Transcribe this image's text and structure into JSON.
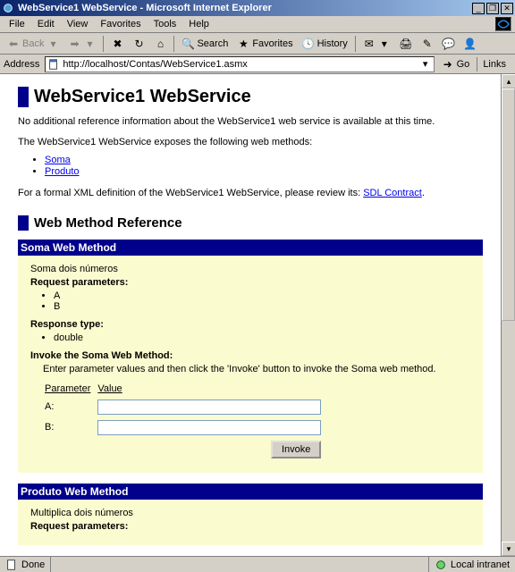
{
  "window": {
    "title": "WebService1 WebService - Microsoft Internet Explorer"
  },
  "menu": {
    "file": "File",
    "edit": "Edit",
    "view": "View",
    "favorites": "Favorites",
    "tools": "Tools",
    "help": "Help"
  },
  "toolbar": {
    "back": "Back",
    "search": "Search",
    "favorites": "Favorites",
    "history": "History"
  },
  "address": {
    "label": "Address",
    "url": "http://localhost/Contas/WebService1.asmx",
    "go": "Go",
    "links": "Links"
  },
  "page": {
    "h1": "WebService1 WebService",
    "intro": "No additional reference information about the WebService1 web service is available at this time.",
    "exposes": "The WebService1 WebService exposes the following web methods:",
    "links": {
      "soma": "Soma",
      "produto": "Produto"
    },
    "formal_pre": "For a formal XML definition of the WebService1 WebService, please review its: ",
    "sdl": "SDL Contract",
    "h2": "Web Method Reference",
    "soma": {
      "bar": "Soma Web Method",
      "desc": "Soma dois números",
      "req_label": "Request parameters:",
      "params": {
        "p1": "A",
        "p2": "B"
      },
      "resp_label": "Response type:",
      "resp": "double",
      "invoke_label": "Invoke the Soma Web Method:",
      "invoke_text": "Enter parameter values and then click the 'Invoke' button to invoke the Soma web method.",
      "table": {
        "hdr_param": "Parameter",
        "hdr_value": "Value",
        "p1": "A:",
        "p2": "B:"
      },
      "invoke_btn": "Invoke"
    },
    "produto": {
      "bar": "Produto Web Method",
      "desc": "Multiplica dois números",
      "req_label": "Request parameters:"
    }
  },
  "status": {
    "done": "Done",
    "zone": "Local intranet"
  }
}
